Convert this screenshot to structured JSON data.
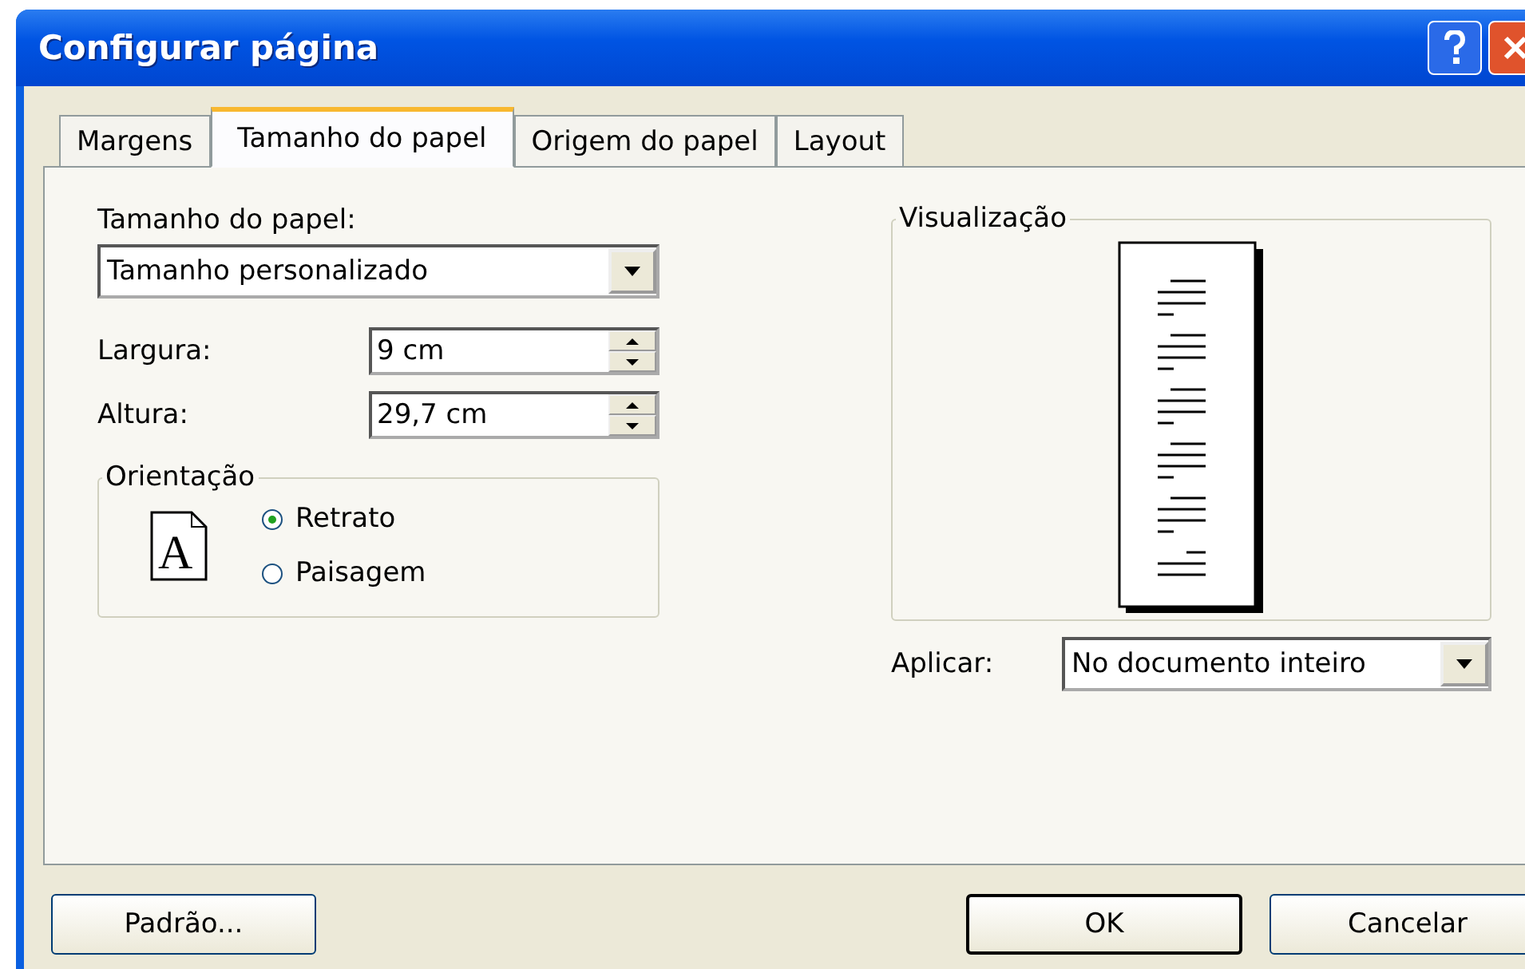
{
  "window": {
    "title": "Configurar página"
  },
  "tabs": [
    {
      "label": "Margens",
      "selected": false
    },
    {
      "label": "Tamanho do papel",
      "selected": true
    },
    {
      "label": "Origem do papel",
      "selected": false
    },
    {
      "label": "Layout",
      "selected": false
    }
  ],
  "paper_size": {
    "label": "Tamanho do papel:",
    "value": "Tamanho personalizado"
  },
  "width": {
    "label": "Largura:",
    "value": "9 cm"
  },
  "height": {
    "label": "Altura:",
    "value": "29,7 cm"
  },
  "orientation": {
    "title": "Orientação",
    "icon_letter": "A",
    "options": [
      {
        "label": "Retrato",
        "selected": true
      },
      {
        "label": "Paisagem",
        "selected": false
      }
    ]
  },
  "preview": {
    "title": "Visualização"
  },
  "apply": {
    "label": "Aplicar:",
    "value": "No documento inteiro"
  },
  "buttons": [
    {
      "label": "Padrão...",
      "kind": "left",
      "default": false
    },
    {
      "label": "OK",
      "kind": "right",
      "default": true
    },
    {
      "label": "Cancelar",
      "kind": "right",
      "default": false
    }
  ]
}
